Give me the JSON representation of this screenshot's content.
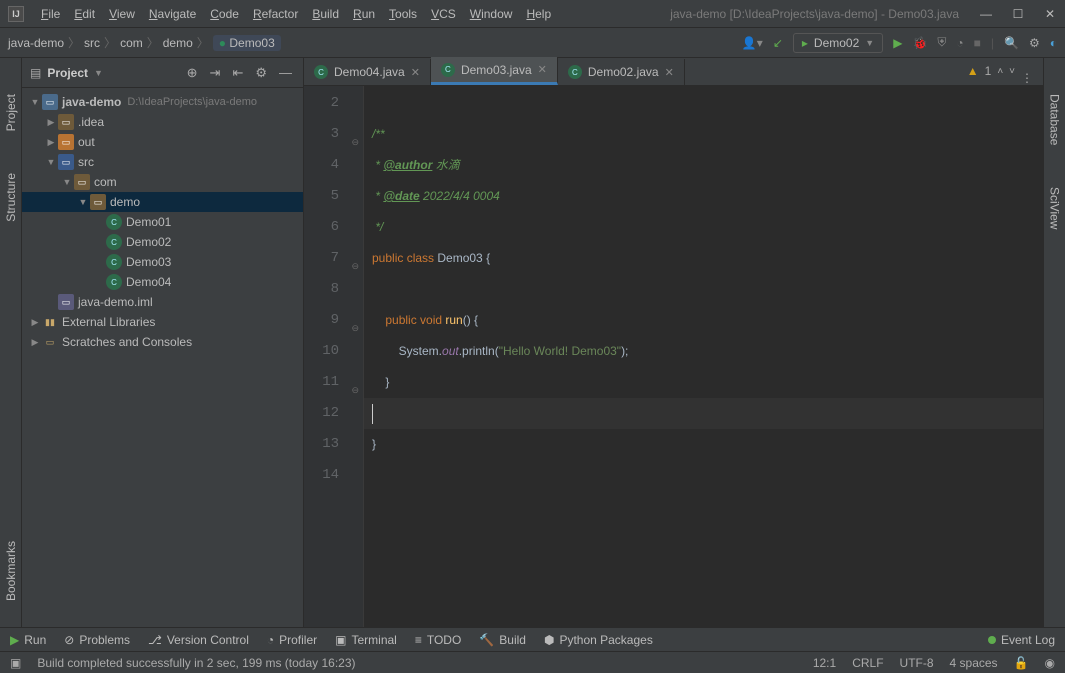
{
  "title": "java-demo [D:\\IdeaProjects\\java-demo] - Demo03.java",
  "logo_text": "IJ",
  "menu": [
    "File",
    "Edit",
    "View",
    "Navigate",
    "Code",
    "Refactor",
    "Build",
    "Run",
    "Tools",
    "VCS",
    "Window",
    "Help"
  ],
  "breadcrumb": [
    "java-demo",
    "src",
    "com",
    "demo",
    "Demo03"
  ],
  "run_config": "Demo02",
  "left_tabs": {
    "project": "Project",
    "structure": "Structure",
    "bookmarks": "Bookmarks"
  },
  "right_tabs": {
    "database": "Database",
    "sciview": "SciView"
  },
  "project_header": "Project",
  "tree": {
    "root": {
      "label": "java-demo",
      "hint": "D:\\IdeaProjects\\java-demo"
    },
    "idea": ".idea",
    "out": "out",
    "src": "src",
    "com": "com",
    "demo": "demo",
    "files": [
      "Demo01",
      "Demo02",
      "Demo03",
      "Demo04"
    ],
    "iml": "java-demo.iml",
    "ext": "External Libraries",
    "scratch": "Scratches and Consoles"
  },
  "tabs": [
    {
      "label": "Demo04.java"
    },
    {
      "label": "Demo03.java"
    },
    {
      "label": "Demo02.java"
    }
  ],
  "inspections": {
    "warn_count": "1"
  },
  "gutter_lines": [
    "2",
    "3",
    "4",
    "5",
    "6",
    "7",
    "8",
    "9",
    "10",
    "11",
    "12",
    "13",
    "14"
  ],
  "code": {
    "star": " * ",
    "author_tag": "@author",
    "author_val": " 水滴",
    "date_tag": "@date",
    "date_val": " 2022/4/4 0004",
    "public": "public ",
    "class": "class ",
    "clsname": "Demo03",
    "brace_o": " {",
    "void": "void ",
    "run": "run",
    "sig": "() {",
    "sys": "System.",
    "out": "out",
    "println": ".println(",
    "str": "\"Hello World! Demo03\"",
    "end": ");",
    "brace_c": "}",
    "open_doc": "/**",
    "close_doc": " */"
  },
  "bottom_tabs": {
    "run": "Run",
    "problems": "Problems",
    "vcs": "Version Control",
    "profiler": "Profiler",
    "terminal": "Terminal",
    "todo": "TODO",
    "build": "Build",
    "python": "Python Packages",
    "event": "Event Log"
  },
  "status": {
    "msg": "Build completed successfully in 2 sec, 199 ms (today 16:23)",
    "pos": "12:1",
    "sep": "CRLF",
    "enc": "UTF-8",
    "indent": "4 spaces"
  }
}
